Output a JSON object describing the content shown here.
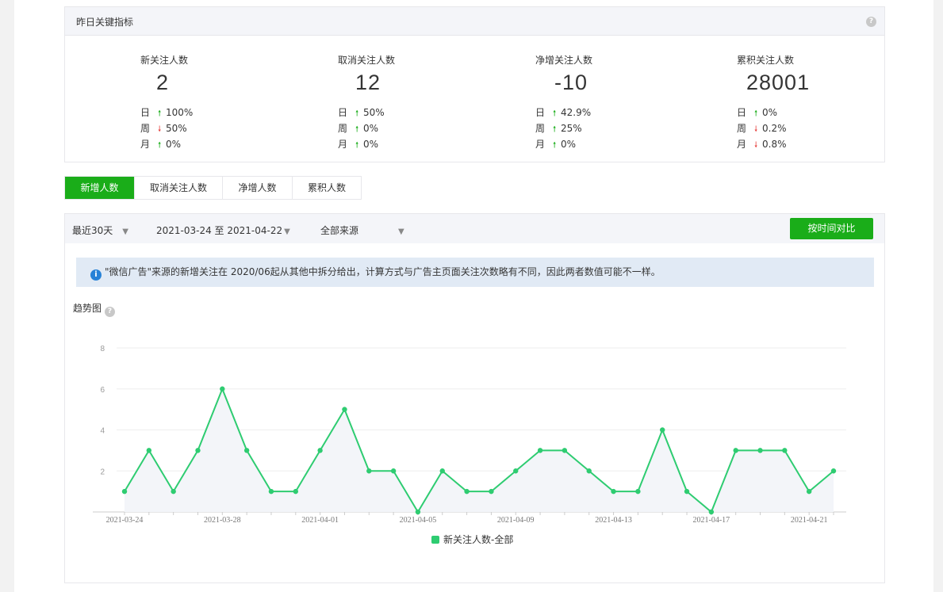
{
  "kpi": {
    "title": "昨日关键指标",
    "help": "?",
    "columns": [
      {
        "label": "新关注人数",
        "value": "2",
        "rows": [
          {
            "period": "日",
            "dir": "up",
            "pct": "100%"
          },
          {
            "period": "周",
            "dir": "down",
            "pct": "50%"
          },
          {
            "period": "月",
            "dir": "up",
            "pct": "0%"
          }
        ]
      },
      {
        "label": "取消关注人数",
        "value": "12",
        "rows": [
          {
            "period": "日",
            "dir": "up",
            "pct": "50%"
          },
          {
            "period": "周",
            "dir": "up",
            "pct": "0%"
          },
          {
            "period": "月",
            "dir": "up",
            "pct": "0%"
          }
        ]
      },
      {
        "label": "净增关注人数",
        "value": "-10",
        "rows": [
          {
            "period": "日",
            "dir": "up",
            "pct": "42.9%"
          },
          {
            "period": "周",
            "dir": "up",
            "pct": "25%"
          },
          {
            "period": "月",
            "dir": "up",
            "pct": "0%"
          }
        ]
      },
      {
        "label": "累积关注人数",
        "value": "28001",
        "rows": [
          {
            "period": "日",
            "dir": "up",
            "pct": "0%"
          },
          {
            "period": "周",
            "dir": "down",
            "pct": "0.2%"
          },
          {
            "period": "月",
            "dir": "down",
            "pct": "0.8%"
          }
        ]
      }
    ]
  },
  "tabs": [
    {
      "label": "新增人数",
      "active": true
    },
    {
      "label": "取消关注人数",
      "active": false
    },
    {
      "label": "净增人数",
      "active": false
    },
    {
      "label": "累积人数",
      "active": false
    }
  ],
  "filters": {
    "range": "最近30天",
    "dates": "2021-03-24 至 2021-04-22",
    "source": "全部来源",
    "caret": "▼",
    "compare_button": "按时间对比"
  },
  "notice": {
    "icon": "i",
    "text": "\"微信广告\"来源的新增关注在 2020/06起从其他中拆分给出，计算方式与广告主页面关注次数略有不同，因此两者数值可能不一样。"
  },
  "trend": {
    "title": "趋势图",
    "help": "?"
  },
  "colors": {
    "accent": "#1aad19",
    "line": "#2ecc71",
    "up": "#1aad19",
    "down": "#e64340"
  },
  "chart_data": {
    "type": "line",
    "x": [
      "2021-03-24",
      "2021-03-25",
      "2021-03-26",
      "2021-03-27",
      "2021-03-28",
      "2021-03-29",
      "2021-03-30",
      "2021-03-31",
      "2021-04-01",
      "2021-04-02",
      "2021-04-03",
      "2021-04-04",
      "2021-04-05",
      "2021-04-06",
      "2021-04-07",
      "2021-04-08",
      "2021-04-09",
      "2021-04-10",
      "2021-04-11",
      "2021-04-12",
      "2021-04-13",
      "2021-04-14",
      "2021-04-15",
      "2021-04-16",
      "2021-04-17",
      "2021-04-18",
      "2021-04-19",
      "2021-04-20",
      "2021-04-21",
      "2021-04-22"
    ],
    "series": [
      {
        "name": "新关注人数-全部",
        "values": [
          1,
          3,
          1,
          3,
          6,
          3,
          1,
          1,
          3,
          5,
          2,
          2,
          0,
          2,
          1,
          1,
          2,
          3,
          3,
          2,
          1,
          1,
          4,
          1,
          0,
          3,
          3,
          3,
          1,
          2
        ]
      }
    ],
    "x_tick_labels": [
      "2021-03-24",
      "2021-03-28",
      "2021-04-01",
      "2021-04-05",
      "2021-04-09",
      "2021-04-13",
      "2021-04-17",
      "2021-04-21"
    ],
    "y_ticks": [
      2,
      4,
      6,
      8
    ],
    "ylim": [
      0,
      8
    ],
    "grid": true,
    "legend": "bottom-center"
  }
}
